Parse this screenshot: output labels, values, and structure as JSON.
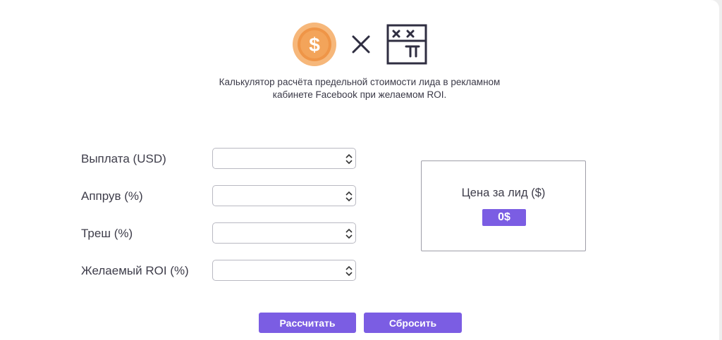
{
  "icons": {
    "coin": "dollar-coin-icon",
    "times": "times-icon",
    "calculator": "calculator-icon"
  },
  "colors": {
    "accent": "#7b5de3",
    "coin_outer": "#f6b77a",
    "coin_inner": "#ef9547",
    "text": "#3e3d4a"
  },
  "description": {
    "line1": "Калькулятор расчёта предельной стоимости лида в рекламном",
    "line2": "кабинете Facebook при желаемом ROI."
  },
  "form": {
    "fields": [
      {
        "label": "Выплата (USD)",
        "value": ""
      },
      {
        "label": "Аппрув (%)",
        "value": ""
      },
      {
        "label": "Треш (%)",
        "value": ""
      },
      {
        "label": "Желаемый ROI (%)",
        "value": ""
      }
    ]
  },
  "result": {
    "label": "Цена за лид ($)",
    "value": "0$"
  },
  "buttons": {
    "calculate": "Рассчитать",
    "reset": "Сбросить"
  }
}
